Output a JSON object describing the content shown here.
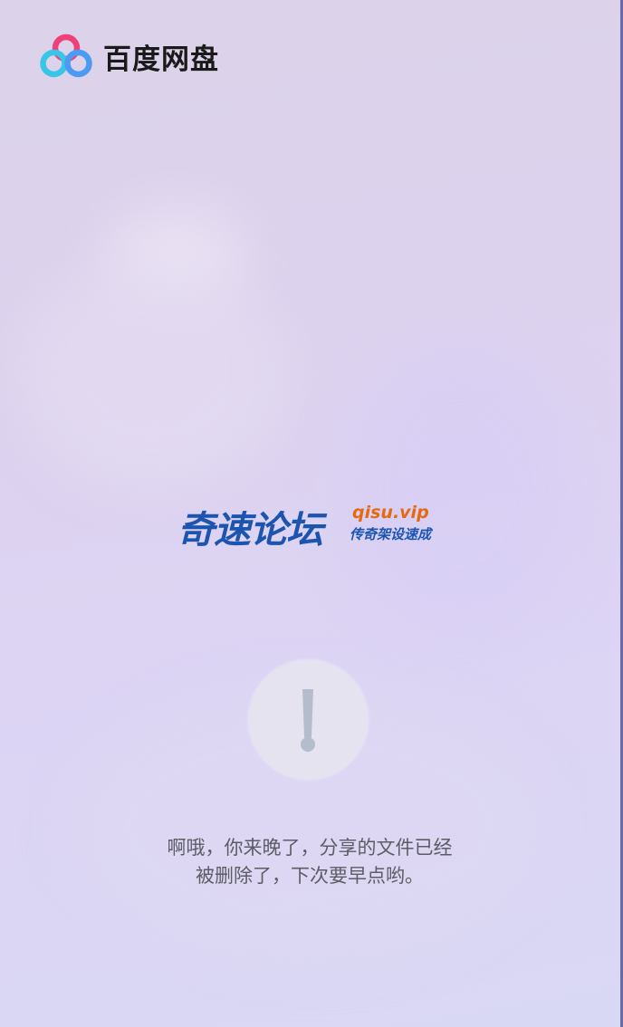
{
  "app": {
    "logo_text": "百度网盘",
    "logo_icon": "baidu-netdisk-logo-icon"
  },
  "watermark": {
    "main_text": "奇速论坛",
    "domain_text": "qisu.vip",
    "slogan_text": "传奇架设速成",
    "colors": {
      "main": "#1c55b0",
      "domain": "#e46a12"
    }
  },
  "notice": {
    "icon": "exclamation-icon",
    "line1": "啊哦，你来晚了，分享的文件已经",
    "line2": "被删除了，下次要早点哟。"
  },
  "colors": {
    "text": "#5c5c66",
    "logo_pink": "#f0407a",
    "logo_blue": "#3fb4f0"
  }
}
